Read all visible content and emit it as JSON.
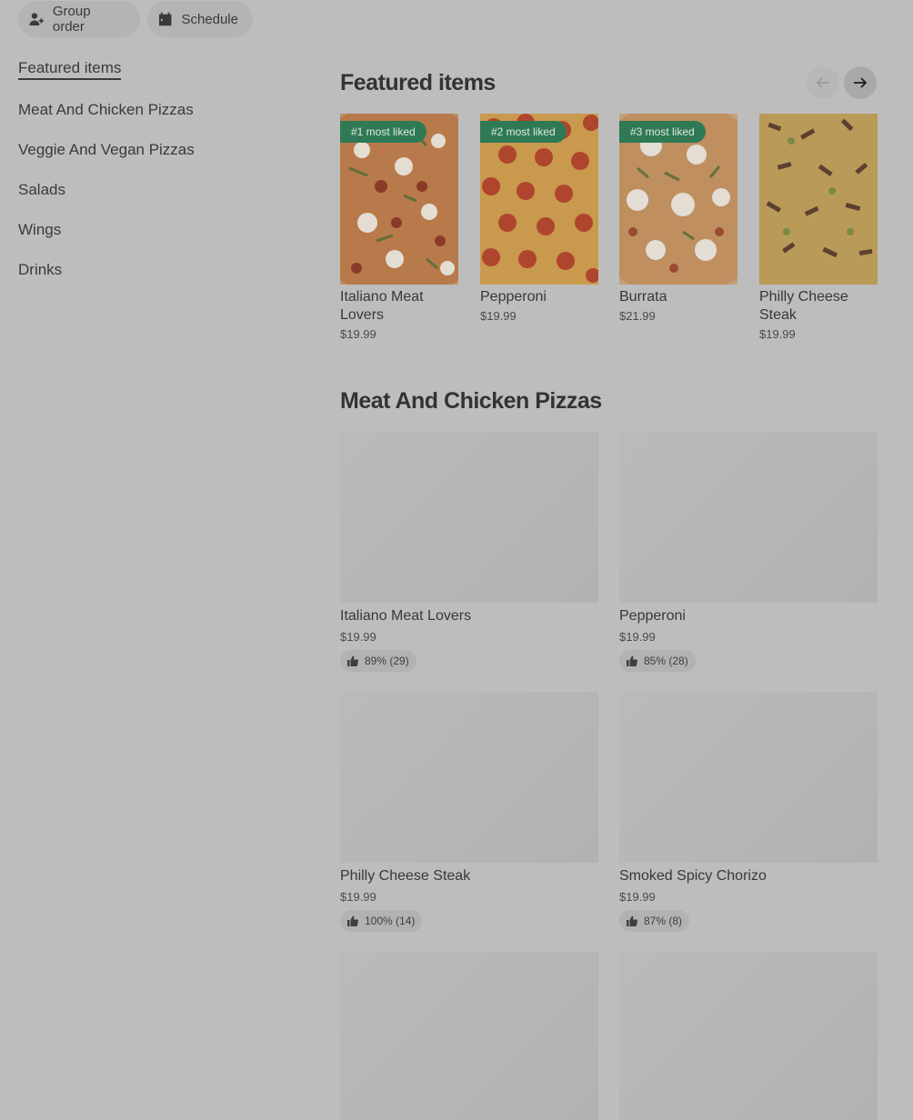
{
  "top_actions": {
    "group_order": "Group order",
    "schedule": "Schedule"
  },
  "sidebar": {
    "items": [
      {
        "label": "Featured items",
        "active": true
      },
      {
        "label": "Meat And Chicken Pizzas"
      },
      {
        "label": "Veggie And Vegan Pizzas"
      },
      {
        "label": "Salads"
      },
      {
        "label": "Wings"
      },
      {
        "label": "Drinks"
      }
    ]
  },
  "featured": {
    "title": "Featured items",
    "items": [
      {
        "badge": "#1 most liked",
        "name": "Italiano Meat Lovers",
        "price": "$19.99"
      },
      {
        "badge": "#2 most liked",
        "name": "Pepperoni",
        "price": "$19.99"
      },
      {
        "badge": "#3 most liked",
        "name": "Burrata",
        "price": "$21.99"
      },
      {
        "badge": "",
        "name": "Philly Cheese Steak",
        "price": "$19.99"
      }
    ]
  },
  "meat_section": {
    "title": "Meat And Chicken Pizzas",
    "items": [
      {
        "name": "Italiano Meat Lovers",
        "price": "$19.99",
        "rating": "89% (29)"
      },
      {
        "name": "Pepperoni",
        "price": "$19.99",
        "rating": "85% (28)"
      },
      {
        "name": "Philly Cheese Steak",
        "price": "$19.99",
        "rating": "100% (14)"
      },
      {
        "name": "Smoked Spicy Chorizo",
        "price": "$19.99",
        "rating": "87% (8)"
      }
    ]
  },
  "colors": {
    "page_overlay": "#bdbdbd",
    "badge_green": "#2f7a55"
  },
  "icons": {
    "group_order": "add-person-icon",
    "schedule": "calendar-icon",
    "rating": "thumbs-up-icon"
  }
}
